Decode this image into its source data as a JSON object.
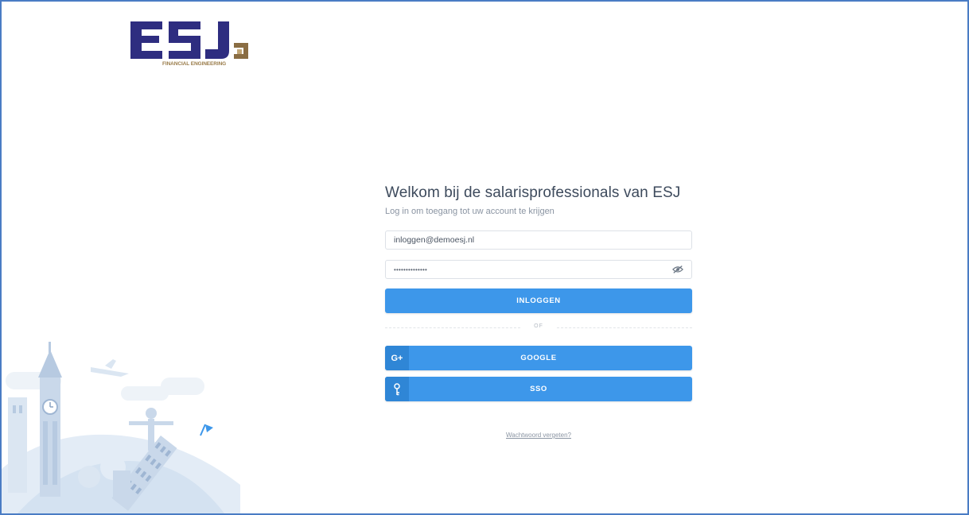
{
  "logo": {
    "letters": "ESJ",
    "tagline": "FINANCIAL ENGINEERING"
  },
  "login": {
    "title": "Welkom bij de salarisprofessionals van ESJ",
    "subtitle": "Log in om toegang tot uw account te krijgen",
    "email_value": "inloggen@demoesj.nl",
    "password_masked": "••••••••••••••",
    "login_button": "INLOGGEN",
    "divider_text": "OF",
    "google_icon": "G+",
    "google_button": "GOOGLE",
    "sso_button": "SSO",
    "forgot_link": "Wachtwoord vergeten?"
  },
  "colors": {
    "primary": "#3d97ea",
    "logo_blue": "#2e2d80",
    "logo_gold": "#9a7c4a",
    "border": "#4a7cc4"
  },
  "icons": {
    "password_toggle": "eye-slash-icon",
    "google": "google-plus-icon",
    "sso": "key-icon"
  }
}
